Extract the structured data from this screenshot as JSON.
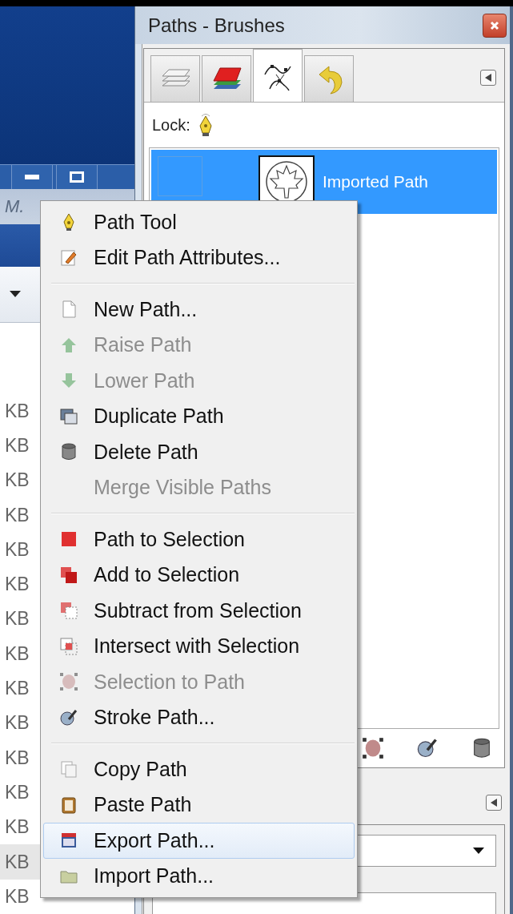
{
  "background_window": {
    "field_text": "M.",
    "size_column": [
      {
        "text": "KB",
        "selected": false
      },
      {
        "text": "KB",
        "selected": false
      },
      {
        "text": "KB",
        "selected": false
      },
      {
        "text": "KB",
        "selected": false
      },
      {
        "text": "KB",
        "selected": false
      },
      {
        "text": "KB",
        "selected": false
      },
      {
        "text": "KB",
        "selected": false
      },
      {
        "text": "KB",
        "selected": false
      },
      {
        "text": "KB",
        "selected": false
      },
      {
        "text": "KB",
        "selected": false
      },
      {
        "text": "KB",
        "selected": false
      },
      {
        "text": "KB",
        "selected": false
      },
      {
        "text": "KB",
        "selected": false
      },
      {
        "text": "KB",
        "selected": true
      },
      {
        "text": "KB",
        "selected": false
      }
    ]
  },
  "dialog": {
    "title": "Paths - Brushes",
    "tabs": [
      {
        "selected": false
      },
      {
        "selected": false
      },
      {
        "selected": true
      },
      {
        "selected": false
      }
    ],
    "lock_label": "Lock:",
    "paths": [
      {
        "name": "Imported Path",
        "selected": true
      }
    ]
  },
  "context_menu": {
    "items": [
      {
        "kind": "item",
        "label": "Path Tool",
        "disabled": false,
        "selected": false
      },
      {
        "kind": "item",
        "label": "Edit Path Attributes...",
        "disabled": false,
        "selected": false
      },
      {
        "kind": "separator"
      },
      {
        "kind": "item",
        "label": "New Path...",
        "disabled": false,
        "selected": false
      },
      {
        "kind": "item",
        "label": "Raise Path",
        "disabled": true,
        "selected": false
      },
      {
        "kind": "item",
        "label": "Lower Path",
        "disabled": true,
        "selected": false
      },
      {
        "kind": "item",
        "label": "Duplicate Path",
        "disabled": false,
        "selected": false
      },
      {
        "kind": "item",
        "label": "Delete Path",
        "disabled": false,
        "selected": false
      },
      {
        "kind": "item",
        "label": "Merge Visible Paths",
        "disabled": true,
        "selected": false
      },
      {
        "kind": "separator"
      },
      {
        "kind": "item",
        "label": "Path to Selection",
        "disabled": false,
        "selected": false
      },
      {
        "kind": "item",
        "label": "Add to Selection",
        "disabled": false,
        "selected": false
      },
      {
        "kind": "item",
        "label": "Subtract from Selection",
        "disabled": false,
        "selected": false
      },
      {
        "kind": "item",
        "label": "Intersect with Selection",
        "disabled": false,
        "selected": false
      },
      {
        "kind": "item",
        "label": "Selection to Path",
        "disabled": true,
        "selected": false
      },
      {
        "kind": "item",
        "label": "Stroke Path...",
        "disabled": false,
        "selected": false
      },
      {
        "kind": "separator"
      },
      {
        "kind": "item",
        "label": "Copy Path",
        "disabled": false,
        "selected": false
      },
      {
        "kind": "item",
        "label": "Paste Path",
        "disabled": false,
        "selected": false
      },
      {
        "kind": "item",
        "label": "Export Path...",
        "disabled": false,
        "selected": true
      },
      {
        "kind": "item",
        "label": "Import Path...",
        "disabled": false,
        "selected": false
      }
    ]
  }
}
